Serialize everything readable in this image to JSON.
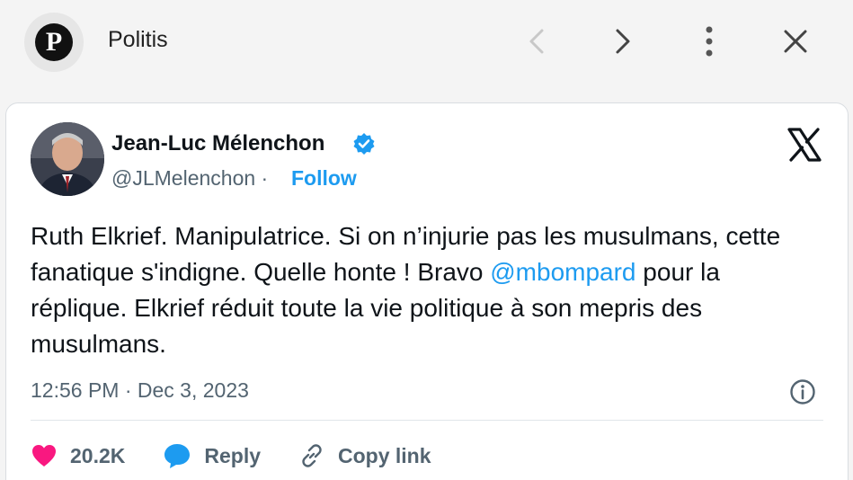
{
  "app": {
    "logo_letter": "P",
    "title": "Politis"
  },
  "nav": {
    "back_icon": "chevron-left-icon",
    "forward_icon": "chevron-right-icon",
    "menu_icon": "more-vertical-icon",
    "close_icon": "close-icon"
  },
  "tweet": {
    "author_name": "Jean-Luc Mélenchon",
    "handle": "@JLMelenchon",
    "separator": " · ",
    "follow_label": "Follow",
    "text_part1": "Ruth Elkrief. Manipulatrice. Si on n’injurie pas les musulmans, cette fanatique s'indigne. Quelle honte ! Bravo ",
    "mention": "@mbompard",
    "text_part2": " pour la réplique. Elkrief réduit toute la vie politique à son mepris des musulmans.",
    "timestamp": "12:56 PM · Dec 3, 2023",
    "likes": "20.2K",
    "reply_label": "Reply",
    "copy_link_label": "Copy link"
  },
  "colors": {
    "accent": "#1d9bf0",
    "like": "#f91880",
    "text": "#0f1419",
    "muted": "#536471"
  }
}
